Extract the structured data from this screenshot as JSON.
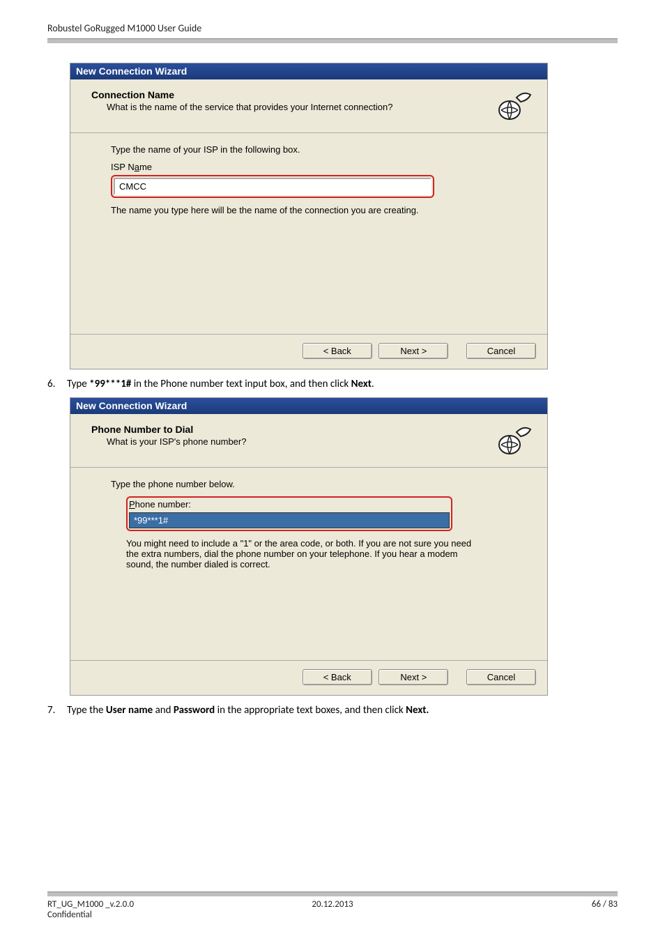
{
  "doc_header": "Robustel GoRugged M1000 User Guide",
  "dialog1": {
    "title_bar": "New Connection Wizard",
    "head_title": "Connection Name",
    "head_sub": "What is the name of the service that provides your Internet connection?",
    "body_label1": "Type the name of your ISP in the following box.",
    "body_label2_pre": "ISP N",
    "body_label2_u": "a",
    "body_label2_post": "me",
    "input_value": "CMCC",
    "note": "The name you type here will be the name of the connection you are creating.",
    "btn_back_pre": "< ",
    "btn_back_u": "B",
    "btn_back_post": "ack",
    "btn_next_u": "N",
    "btn_next_post": "ext >",
    "btn_cancel": "Cancel"
  },
  "step6": {
    "num": "6.",
    "pre": "Type ",
    "bold1": "*99***1#",
    "mid": " in the Phone number text input box, and then click ",
    "bold2": "Next",
    "post": "."
  },
  "dialog2": {
    "title_bar": "New Connection Wizard",
    "head_title": "Phone Number to Dial",
    "head_sub": "What is your ISP's phone number?",
    "body_label1": "Type the phone number below.",
    "body_label2_u": "P",
    "body_label2_post": "hone number:",
    "input_value": "*99***1#",
    "note": "You might need to include a \"1\" or the area code, or both. If you are not sure you need the extra numbers, dial the phone number on your telephone. If you hear a modem sound, the number dialed is correct.",
    "btn_back_pre": "< ",
    "btn_back_u": "B",
    "btn_back_post": "ack",
    "btn_next_u": "N",
    "btn_next_post": "ext >",
    "btn_cancel": "Cancel"
  },
  "step7": {
    "num": "7.",
    "pre": "Type the ",
    "bold1": "User name",
    "mid1": " and ",
    "bold2": "Password",
    "mid2": " in the appropriate text boxes, and then click ",
    "bold3": "Next.",
    "post": ""
  },
  "footer": {
    "left": "RT_UG_M1000 _v.2.0.0",
    "center": "20.12.2013",
    "right": "66 / 83",
    "left2": "Confidential"
  }
}
